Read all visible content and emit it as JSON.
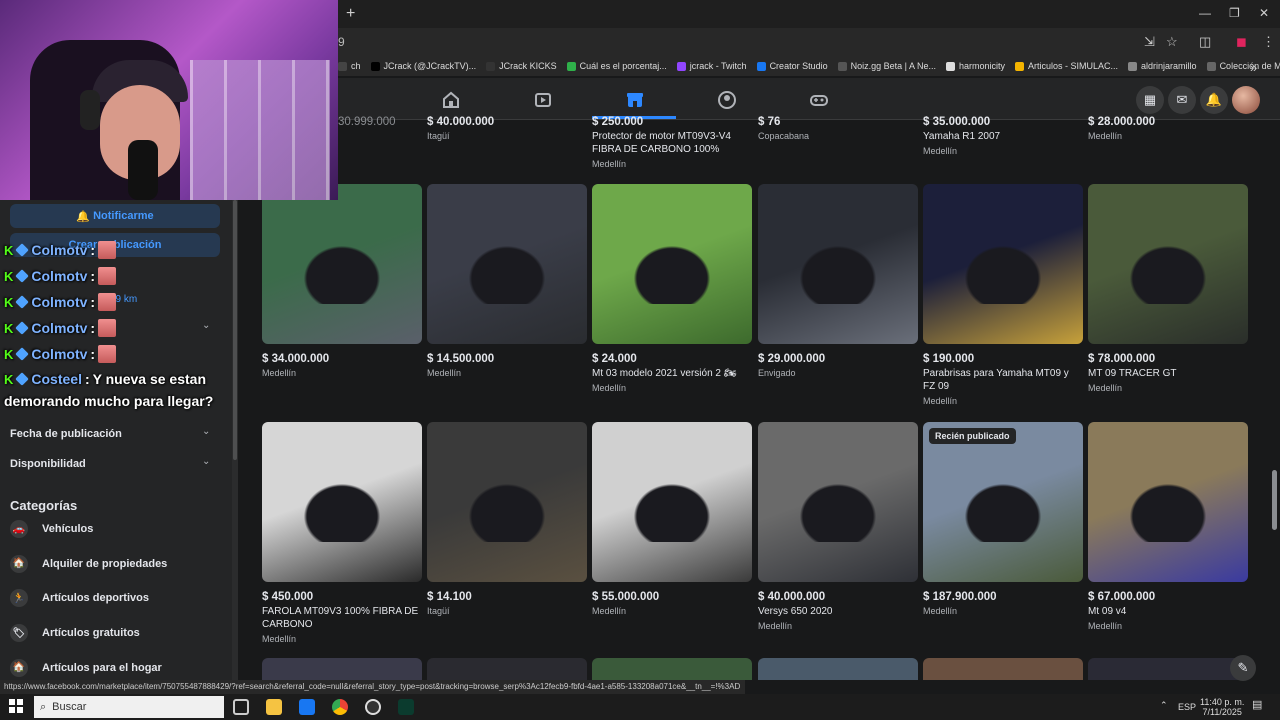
{
  "browser": {
    "new_tab": "+",
    "minimize": "—",
    "restore": "❐",
    "close": "✕",
    "url_fragment": "9",
    "bookmarks": [
      {
        "label": "ch",
        "color": "#444"
      },
      {
        "label": "JCrack (@JCrackTV)...",
        "color": "#000"
      },
      {
        "label": "JCrack KICKS",
        "color": "#333"
      },
      {
        "label": "Cuál es el porcentaj...",
        "color": "#2fb04a"
      },
      {
        "label": "jcrack - Twitch",
        "color": "#9146ff"
      },
      {
        "label": "Creator Studio",
        "color": "#1877f2"
      },
      {
        "label": "Noiz.gg Beta | A Ne...",
        "color": "#555"
      },
      {
        "label": "harmonicity",
        "color": "#ddd"
      },
      {
        "label": "Articulos - SIMULAC...",
        "color": "#f4b400"
      },
      {
        "label": "aldrinjaramillo",
        "color": "#888"
      },
      {
        "label": "Colección de M_blei...",
        "color": "#666"
      }
    ],
    "status_url": "https://www.facebook.com/marketplace/item/750755487888429/?ref=search&referral_code=null&referral_story_type=post&tracking=browse_serp%3Ac12fecb9-fbfd-4ae1-a585-133208a071ce&__tn__=!%3AD"
  },
  "sidebar": {
    "notify_button": "Notificarme",
    "create_button": "Crear publicación",
    "distance": "49 km",
    "filters": [
      {
        "label": "Fecha de publicación"
      },
      {
        "label": "Disponibilidad"
      }
    ],
    "categories_heading": "Categorías",
    "categories": [
      {
        "label": "Vehículos",
        "icon": "🚗"
      },
      {
        "label": "Alquiler de propiedades",
        "icon": "🏠"
      },
      {
        "label": "Artículos deportivos",
        "icon": "🏃"
      },
      {
        "label": "Artículos gratuitos",
        "icon": "🏷"
      },
      {
        "label": "Artículos para el hogar",
        "icon": "🏠"
      }
    ]
  },
  "chat": [
    {
      "nick": "Colmotv",
      "sep": ":"
    },
    {
      "nick": "Colmotv",
      "sep": ":"
    },
    {
      "nick": "Colmotv",
      "sep": ":"
    },
    {
      "nick": "Colmotv",
      "sep": ":"
    },
    {
      "nick": "Colmotv",
      "sep": ":"
    },
    {
      "nick": "Costeel",
      "sep": ":",
      "message": "Y nueva se estan",
      "message2": "demorando mucho para llegar?"
    }
  ],
  "top_row": [
    {
      "price": "30.999.000",
      "title": "",
      "loc": ""
    },
    {
      "price": "$ 40.000.000",
      "title": "",
      "loc": "Itagüí"
    },
    {
      "price": "$ 250.000",
      "title": "Protector de motor MT09V3-V4 FIBRA DE CARBONO 100%",
      "loc": "Medellín"
    },
    {
      "price": "$ 76",
      "title": "",
      "loc": "Copacabana"
    },
    {
      "price": "$ 35.000.000",
      "title": "Yamaha R1 2007",
      "loc": "Medellín"
    },
    {
      "price": "$ 28.000.000",
      "title": "",
      "loc": "Medellín"
    }
  ],
  "row1": [
    {
      "price": "$ 34.000.000",
      "title": "",
      "loc": "Medellín"
    },
    {
      "price": "$ 14.500.000",
      "title": "",
      "loc": "Medellín"
    },
    {
      "price": "$ 24.000",
      "title": "Mt 03 modelo 2021 versión 2 🏍",
      "loc": "Medellín"
    },
    {
      "price": "$ 29.000.000",
      "title": "",
      "loc": "Envigado"
    },
    {
      "price": "$ 190.000",
      "title": "Parabrisas para Yamaha MT09 y FZ 09",
      "loc": "Medellín"
    },
    {
      "price": "$ 78.000.000",
      "title": "MT 09 TRACER GT",
      "loc": "Medellín"
    }
  ],
  "row2": [
    {
      "price": "$ 450.000",
      "title": "FAROLA MT09V3 100% FIBRA DE CARBONO",
      "loc": "Medellín"
    },
    {
      "price": "$ 14.100",
      "title": "",
      "loc": "Itagüí"
    },
    {
      "price": "$ 55.000.000",
      "title": "",
      "loc": "Medellín"
    },
    {
      "price": "$ 40.000.000",
      "title": "Versys 650 2020",
      "loc": "Medellín"
    },
    {
      "price": "$ 187.900.000",
      "title": "",
      "loc": "Medellín",
      "badge": "Recién publicado"
    },
    {
      "price": "$ 67.000.000",
      "title": "Mt 09 v4",
      "loc": "Medellín"
    }
  ],
  "taskbar": {
    "search": "Buscar",
    "lang": "ESP",
    "time": "11:40 p. m.",
    "date": "7/11/2025"
  }
}
